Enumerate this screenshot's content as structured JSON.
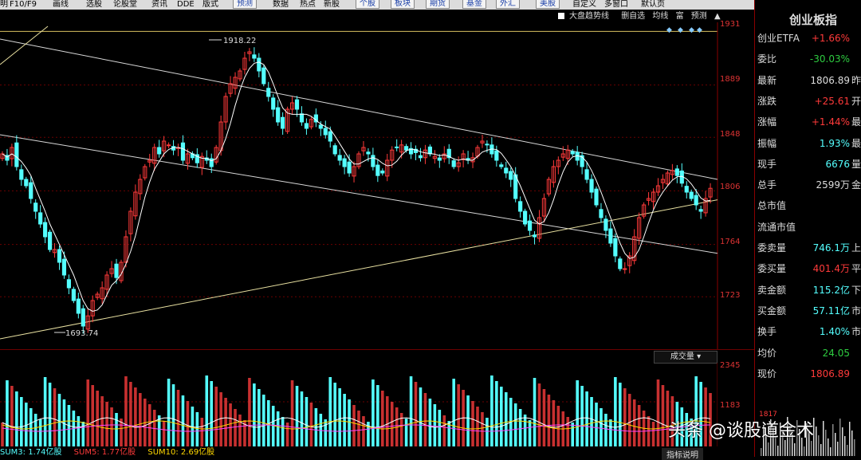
{
  "menubar": {
    "items": [
      "明",
      "F10/F9",
      "画线",
      "选股",
      "论股堂",
      "资讯",
      "DDE",
      "版式",
      "预测",
      "数据",
      "热点",
      "新股",
      "个股",
      "板块",
      "期货",
      "基金",
      "外汇",
      "美股",
      "自定义",
      "多窗口",
      "默认页"
    ]
  },
  "toolbar": {
    "trend_label": "大盘趋势线",
    "delete_self_label": "删自选",
    "ma_label": "均线",
    "cheat_label": "富",
    "forecast_label": "预测"
  },
  "right_panel": {
    "title": "创业板指",
    "rows": [
      {
        "k": "创业ETFA",
        "v": "+1.66%",
        "color": "red",
        "x": ""
      },
      {
        "k": "委比",
        "v": "-30.03%",
        "color": "green",
        "x": ""
      },
      {
        "k": "最新",
        "v": "1806.89",
        "color": "white",
        "x": "昨"
      },
      {
        "k": "涨跌",
        "v": "+25.61",
        "color": "red",
        "x": "开"
      },
      {
        "k": "涨幅",
        "v": "+1.44%",
        "color": "red",
        "x": "最"
      },
      {
        "k": "振幅",
        "v": "1.93%",
        "color": "cyan",
        "x": "最"
      },
      {
        "k": "现手",
        "v": "6676",
        "color": "cyan",
        "x": "量"
      },
      {
        "k": "总手",
        "v": "2599万",
        "color": "white",
        "x": "金"
      },
      {
        "k": "总市值",
        "v": "",
        "color": "white",
        "x": ""
      },
      {
        "k": "流通市值",
        "v": "",
        "color": "white",
        "x": ""
      },
      {
        "k": "委卖量",
        "v": "746.1万",
        "color": "cyan",
        "x": "上"
      },
      {
        "k": "委买量",
        "v": "401.4万",
        "color": "red",
        "x": "平"
      },
      {
        "k": "卖金额",
        "v": "115.2亿",
        "color": "cyan",
        "x": "下"
      },
      {
        "k": "买金额",
        "v": "57.11亿",
        "color": "cyan",
        "x": "市"
      },
      {
        "k": "换手",
        "v": "1.40%",
        "color": "cyan",
        "x": "市"
      },
      {
        "k": "均价",
        "v": "24.05",
        "color": "green",
        "x": ""
      },
      {
        "k": "现价",
        "v": "1806.89",
        "color": "red",
        "x": ""
      }
    ],
    "mini_top": "1817"
  },
  "price_axis": {
    "labels": [
      "1931",
      "1889",
      "1848",
      "1806",
      "1764",
      "1723"
    ]
  },
  "annotations": {
    "high_label": "1918.22",
    "low_label": "1693.74"
  },
  "volume": {
    "dropdown": "成交量",
    "axis_labels": [
      "2345",
      "1183"
    ]
  },
  "status": {
    "sum3": "SUM3: 1.74亿股",
    "sum5": "SUM5: 1.77亿股",
    "sum10": "SUM10: 2.69亿股",
    "help": "指标说明"
  },
  "watermark": "头条 @谈股道金术",
  "colors": {
    "up": "#ff3a3a",
    "down": "#54ffff",
    "ma": "#ffffff",
    "trend": "#e8e0a0",
    "grid": "#6b0000"
  },
  "chart_data": {
    "type": "candlestick",
    "ylim": [
      1685,
      1935
    ],
    "closes": [
      1835,
      1830,
      1840,
      1825,
      1815,
      1810,
      1800,
      1790,
      1780,
      1770,
      1760,
      1760,
      1750,
      1740,
      1730,
      1720,
      1710,
      1700,
      1708,
      1720,
      1725,
      1730,
      1740,
      1745,
      1738,
      1750,
      1770,
      1790,
      1805,
      1815,
      1825,
      1830,
      1840,
      1835,
      1845,
      1842,
      1838,
      1840,
      1830,
      1835,
      1832,
      1828,
      1833,
      1830,
      1825,
      1840,
      1860,
      1880,
      1890,
      1895,
      1900,
      1910,
      1915,
      1910,
      1900,
      1890,
      1880,
      1870,
      1860,
      1855,
      1870,
      1875,
      1870,
      1860,
      1855,
      1862,
      1860,
      1855,
      1850,
      1845,
      1835,
      1830,
      1825,
      1820,
      1825,
      1835,
      1840,
      1835,
      1825,
      1818,
      1820,
      1830,
      1838,
      1840,
      1842,
      1838,
      1835,
      1836,
      1832,
      1838,
      1835,
      1833,
      1830,
      1835,
      1832,
      1825,
      1828,
      1835,
      1830,
      1832,
      1840,
      1845,
      1842,
      1835,
      1830,
      1825,
      1820,
      1815,
      1800,
      1790,
      1780,
      1775,
      1770,
      1785,
      1800,
      1815,
      1825,
      1830,
      1835,
      1838,
      1835,
      1830,
      1825,
      1815,
      1805,
      1795,
      1785,
      1775,
      1765,
      1755,
      1745,
      1745,
      1755,
      1770,
      1785,
      1795,
      1800,
      1805,
      1810,
      1815,
      1820,
      1822,
      1818,
      1812,
      1805,
      1800,
      1795,
      1790,
      1800,
      1808
    ]
  }
}
